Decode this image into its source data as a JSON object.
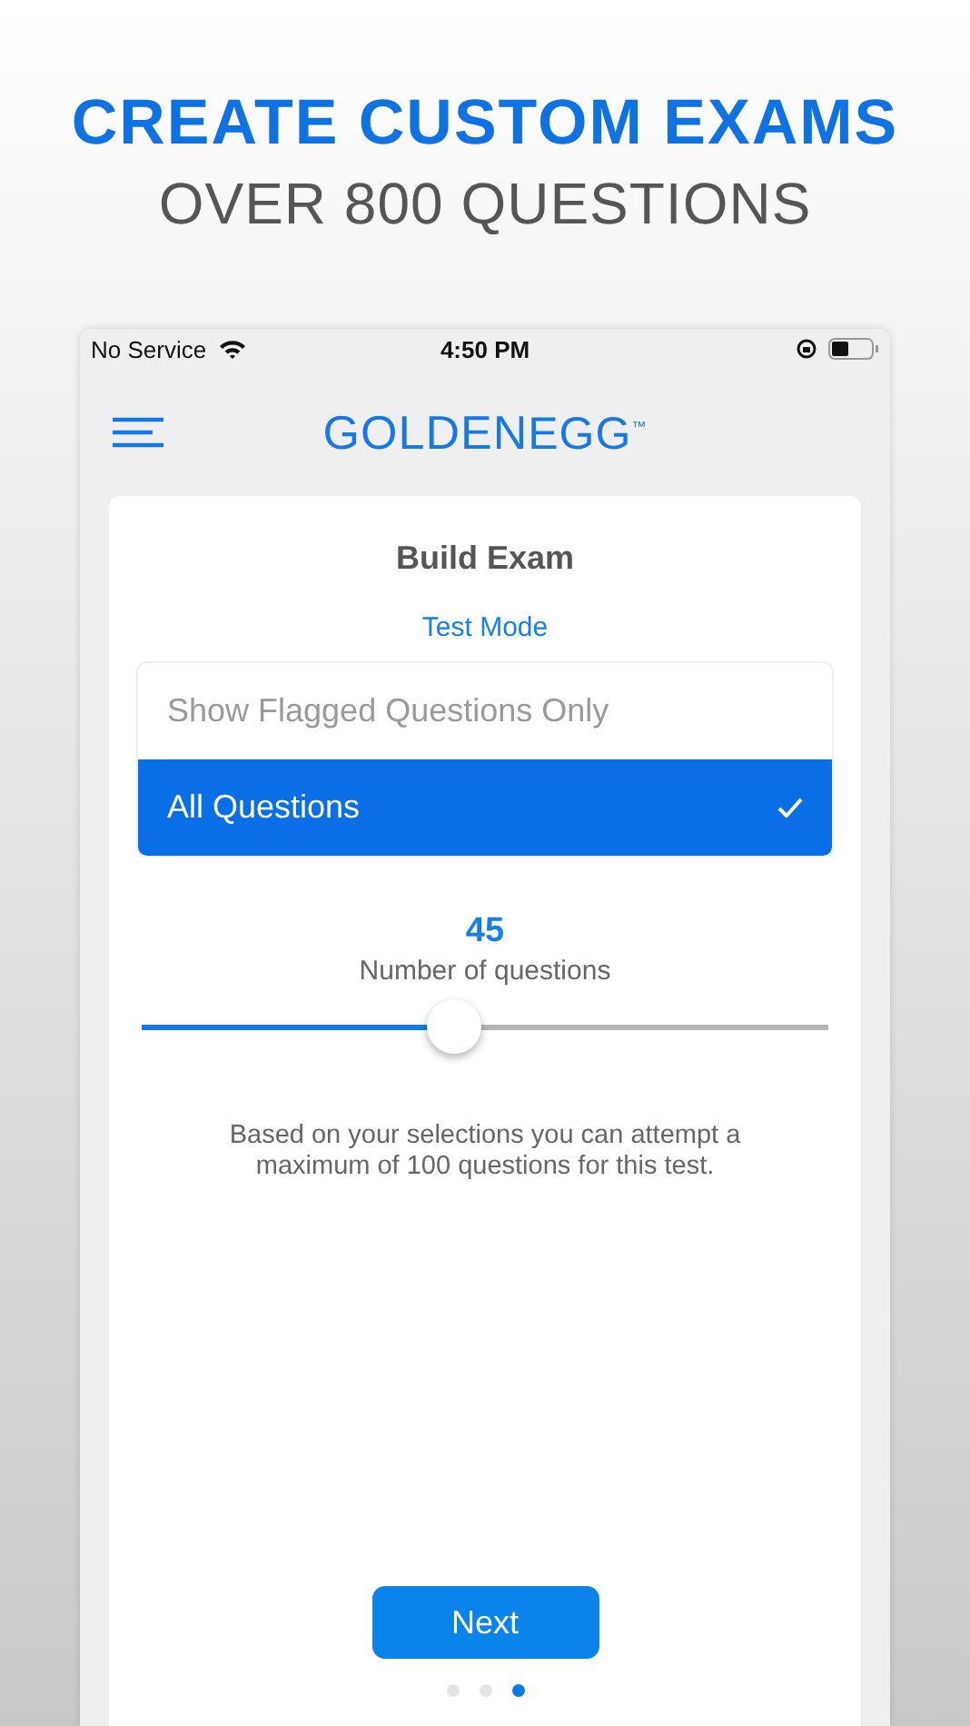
{
  "headline": {
    "title": "CREATE CUSTOM EXAMS",
    "subtitle": "OVER 800 QUESTIONS"
  },
  "status_bar": {
    "carrier": "No Service",
    "time": "4:50 PM"
  },
  "nav": {
    "logo": {
      "bold": "GOLDEN",
      "light": "EGG",
      "mark": "™"
    }
  },
  "card": {
    "title": "Build Exam",
    "mode": "Test Mode",
    "options": [
      {
        "label": "Show Flagged Questions Only",
        "selected": false
      },
      {
        "label": "All Questions",
        "selected": true
      }
    ],
    "count": "45",
    "count_label": "Number of questions",
    "slider": {
      "level": 0.456
    },
    "note": "Based on your selections you can attempt a maximum of 100 questions for this test.",
    "button": "Next",
    "pages": [
      {
        "selected": false
      },
      {
        "selected": false
      },
      {
        "selected": true
      }
    ]
  }
}
